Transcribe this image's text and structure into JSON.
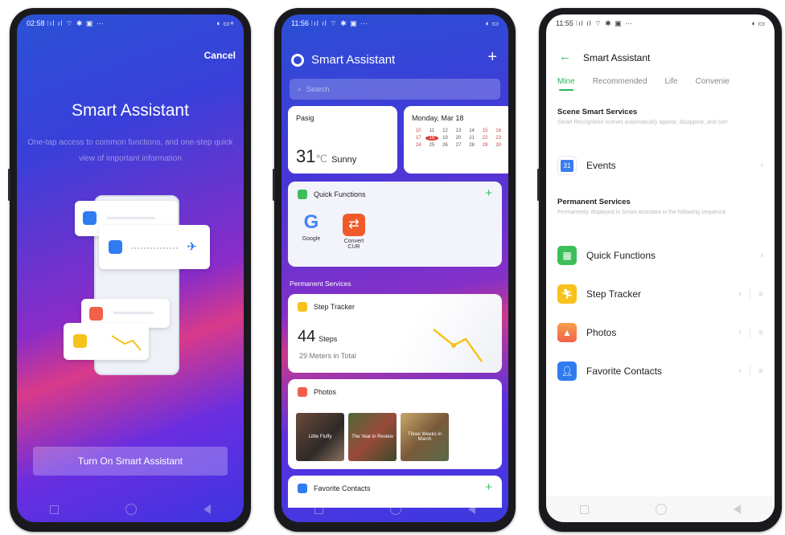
{
  "colors": {
    "accent_green": "#2cb55a",
    "gradient_start": "#2a52d6",
    "gradient_end": "#3e35e0"
  },
  "phone1": {
    "status_time": "02:58",
    "cancel_label": "Cancel",
    "title": "Smart Assistant",
    "description": "One-tap access to common functions, and one-step quick view of important information",
    "turn_on_label": "Turn On Smart Assistant"
  },
  "phone2": {
    "status_time": "11:56",
    "title": "Smart Assistant",
    "search_placeholder": "Search",
    "weather": {
      "location": "Pasig",
      "temp": "31",
      "unit": "℃",
      "condition": "Sunny"
    },
    "calendar": {
      "date_label": "Monday, Mar 18",
      "rows": [
        [
          "10",
          "11",
          "12",
          "13",
          "14",
          "15",
          "16"
        ],
        [
          "17",
          "18",
          "19",
          "20",
          "21",
          "22",
          "23"
        ],
        [
          "24",
          "25",
          "26",
          "27",
          "28",
          "29",
          "30"
        ]
      ],
      "selected": "18"
    },
    "quick_functions": {
      "title": "Quick Functions",
      "apps": [
        {
          "label": "Google",
          "icon": "google-icon"
        },
        {
          "label": "Convert\nCUR",
          "icon": "currency-convert-icon"
        }
      ]
    },
    "permanent_services_label": "Permanent Services",
    "step_tracker": {
      "title": "Step Tracker",
      "steps": "44",
      "steps_unit": "Steps",
      "meters": "29",
      "meters_label": "Meters in Total"
    },
    "photos": {
      "title": "Photos",
      "captions": [
        "Little Fluffy",
        "The Year in Review",
        "Three Weeks in March"
      ]
    },
    "favorite_contacts": {
      "title": "Favorite Contacts"
    }
  },
  "phone3": {
    "status_time": "11:55",
    "title": "Smart Assistant",
    "tabs": [
      "Mine",
      "Recommended",
      "Life",
      "Convenie"
    ],
    "scene_header": "Scene Smart Services",
    "scene_desc": "Smart Recognition scenes automatically appear, disappear, and sort",
    "events_label": "Events",
    "events_icon_number": "31",
    "permanent_header": "Permanent Services",
    "permanent_desc": "Permanently displayed in Smart Assistant in the following sequence",
    "services": [
      {
        "label": "Quick Functions",
        "icon": "quick-functions-icon",
        "color": "#3cbf5a"
      },
      {
        "label": "Step Tracker",
        "icon": "step-tracker-icon",
        "color": "#f6c21b"
      },
      {
        "label": "Photos",
        "icon": "photos-icon",
        "color": "#f0604a"
      },
      {
        "label": "Favorite Contacts",
        "icon": "contacts-icon",
        "color": "#2f7cf0"
      }
    ]
  }
}
